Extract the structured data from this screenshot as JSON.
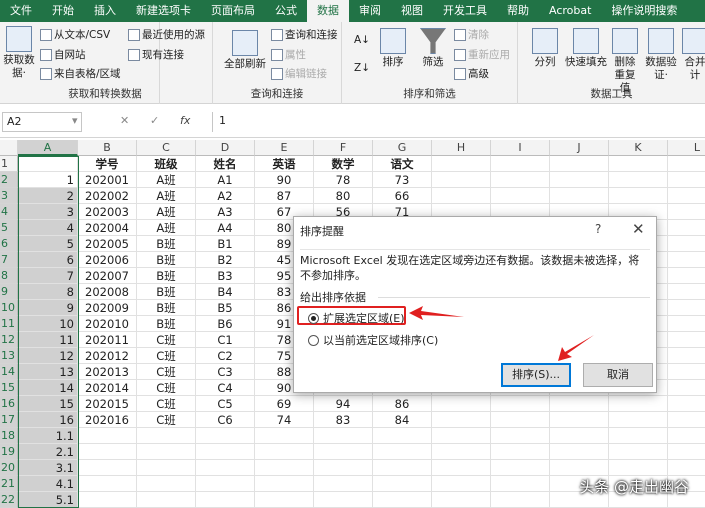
{
  "tabs": [
    "文件",
    "开始",
    "插入",
    "新建选项卡",
    "页面布局",
    "公式",
    "数据",
    "审阅",
    "视图",
    "开发工具",
    "帮助",
    "Acrobat",
    "操作说明搜索"
  ],
  "active_tab": "数据",
  "ribbon": {
    "get": {
      "label": "获取和转换数据",
      "get_data": "获取数据·",
      "from_text": "从文本/CSV",
      "from_web": "自网站",
      "from_table": "来自表格/区域",
      "recent": "最近使用的源",
      "existing": "现有连接"
    },
    "query": {
      "label": "查询和连接",
      "refresh_all": "全部刷新",
      "queries": "查询和连接",
      "properties": "属性",
      "edit_links": "编辑链接"
    },
    "sort": {
      "label": "排序和筛选",
      "sort": "排序",
      "filter": "筛选",
      "clear": "清除",
      "reapply": "重新应用",
      "advanced": "高级"
    },
    "tools": {
      "label": "数据工具",
      "split": "分列",
      "flash_fill": "快速填充",
      "remove_dup": "删除重复值",
      "validation": "数据验证·",
      "merge": "合并计"
    }
  },
  "formula_bar": {
    "name_box": "A2",
    "value": "1",
    "fx": "fx"
  },
  "columns": [
    "A",
    "B",
    "C",
    "D",
    "E",
    "F",
    "G",
    "H",
    "I",
    "J",
    "K",
    "L"
  ],
  "rows": [
    [
      "",
      "学号",
      "班级",
      "姓名",
      "英语",
      "数学",
      "语文"
    ],
    [
      "1",
      "202001",
      "A班",
      "A1",
      "90",
      "78",
      "73"
    ],
    [
      "2",
      "202002",
      "A班",
      "A2",
      "87",
      "80",
      "66"
    ],
    [
      "3",
      "202003",
      "A班",
      "A3",
      "67",
      "56",
      "71"
    ],
    [
      "4",
      "202004",
      "A班",
      "A4",
      "80",
      "",
      ""
    ],
    [
      "5",
      "202005",
      "B班",
      "B1",
      "89",
      "",
      ""
    ],
    [
      "6",
      "202006",
      "B班",
      "B2",
      "45",
      "",
      ""
    ],
    [
      "7",
      "202007",
      "B班",
      "B3",
      "95",
      "",
      ""
    ],
    [
      "8",
      "202008",
      "B班",
      "B4",
      "83",
      "",
      ""
    ],
    [
      "9",
      "202009",
      "B班",
      "B5",
      "86",
      "",
      ""
    ],
    [
      "10",
      "202010",
      "B班",
      "B6",
      "91",
      "",
      ""
    ],
    [
      "11",
      "202011",
      "C班",
      "C1",
      "78",
      "",
      ""
    ],
    [
      "12",
      "202012",
      "C班",
      "C2",
      "75",
      "",
      ""
    ],
    [
      "13",
      "202013",
      "C班",
      "C3",
      "88",
      "",
      ""
    ],
    [
      "14",
      "202014",
      "C班",
      "C4",
      "90",
      "",
      ""
    ],
    [
      "15",
      "202015",
      "C班",
      "C5",
      "69",
      "94",
      "86"
    ],
    [
      "16",
      "202016",
      "C班",
      "C6",
      "74",
      "83",
      "84"
    ],
    [
      "1.1",
      "",
      "",
      "",
      "",
      "",
      ""
    ],
    [
      "2.1",
      "",
      "",
      "",
      "",
      "",
      ""
    ],
    [
      "3.1",
      "",
      "",
      "",
      "",
      "",
      ""
    ],
    [
      "4.1",
      "",
      "",
      "",
      "",
      "",
      ""
    ],
    [
      "5.1",
      "",
      "",
      "",
      "",
      "",
      ""
    ]
  ],
  "dialog": {
    "title": "排序提醒",
    "help": "?",
    "close": "✕",
    "message": "Microsoft Excel 发现在选定区域旁边还有数据。该数据未被选择，将不参加排序。",
    "section": "给出排序依据",
    "option1": "扩展选定区域(E)",
    "option2": "以当前选定区域排序(C)",
    "selected": "option1",
    "sort_button": "排序(S)...",
    "cancel_button": "取消"
  },
  "watermark": "头条 @走出幽谷",
  "colors": {
    "accent": "#217346",
    "highlight": "#e02020"
  }
}
